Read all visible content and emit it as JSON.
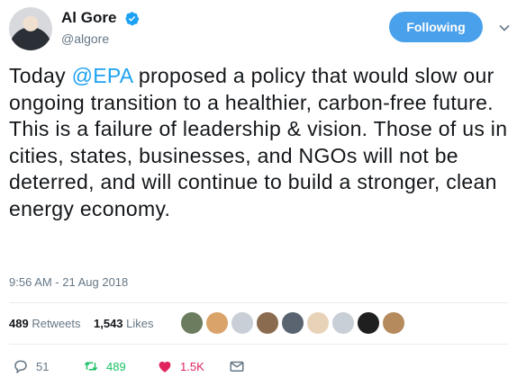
{
  "user": {
    "display_name": "Al Gore",
    "handle": "@algore",
    "follow_label": "Following"
  },
  "tweet": {
    "text_before": "Today ",
    "mention": "@EPA",
    "text_after": " proposed a policy that would slow our ongoing transition to a healthier, carbon-free future. This is a failure of leadership & vision. Those of us in cities, states, businesses, and NGOs will not be deterred, and will continue to build a stronger, clean energy economy.",
    "timestamp": "9:56 AM - 21 Aug 2018"
  },
  "stats": {
    "retweets_count": "489",
    "retweets_label": "Retweets",
    "likes_count": "1,543",
    "likes_label": "Likes"
  },
  "actions": {
    "reply_count": "51",
    "retweet_count": "489",
    "like_count": "1.5K"
  },
  "colors": {
    "accent": "#1da1f2",
    "follow_button": "#4aa1eb",
    "retweet": "#17bf63",
    "like": "#e0245e",
    "muted": "#657786"
  }
}
